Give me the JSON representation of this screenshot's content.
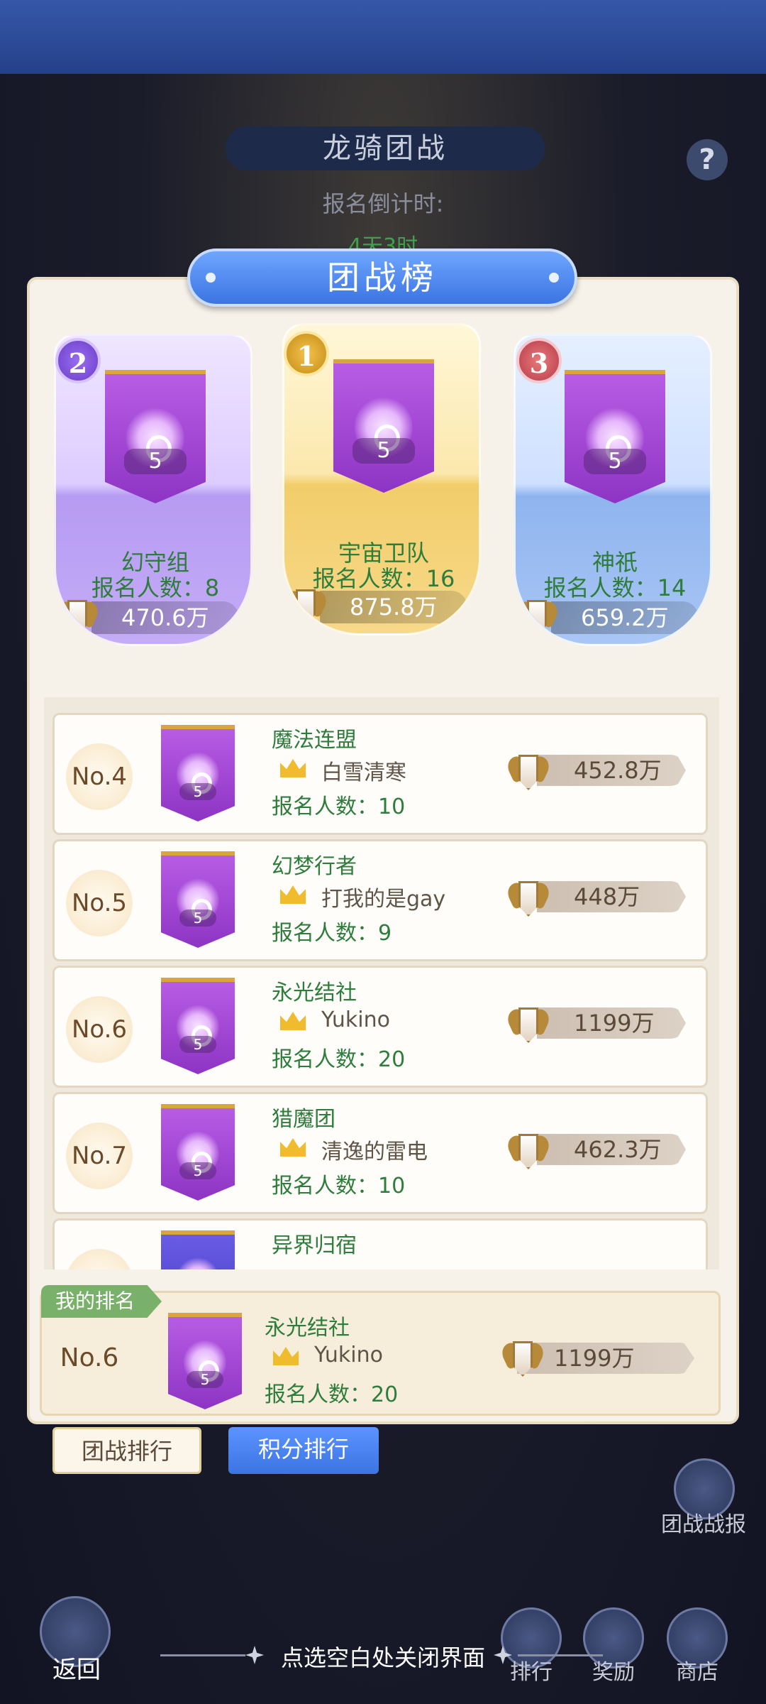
{
  "background": {
    "title": "龙骑团战",
    "countdown_label": "报名倒计时:",
    "countdown_value": "4天3时"
  },
  "panel": {
    "title": "团战榜"
  },
  "podium": [
    {
      "rank": "2",
      "name": "幻守组",
      "count_label": "报名人数：8",
      "score": "470.6万",
      "level": "5"
    },
    {
      "rank": "1",
      "name": "宇宙卫队",
      "count_label": "报名人数：16",
      "score": "875.8万",
      "level": "5"
    },
    {
      "rank": "3",
      "name": "神祇",
      "count_label": "报名人数：14",
      "score": "659.2万",
      "level": "5"
    }
  ],
  "list": [
    {
      "rank": "No.4",
      "name": "魔法连盟",
      "leader": "白雪清寒",
      "count_label": "报名人数：10",
      "score": "452.8万",
      "level": "5"
    },
    {
      "rank": "No.5",
      "name": "幻梦行者",
      "leader": "打我的是gay",
      "count_label": "报名人数：9",
      "score": "448万",
      "level": "5"
    },
    {
      "rank": "No.6",
      "name": "永光结社",
      "leader": "Yukino",
      "count_label": "报名人数：20",
      "score": "1199万",
      "level": "5"
    },
    {
      "rank": "No.7",
      "name": "猎魔团",
      "leader": "清逸的雷电",
      "count_label": "报名人数：10",
      "score": "462.3万",
      "level": "5"
    },
    {
      "rank": "",
      "name": "异界归宿",
      "leader": "",
      "count_label": "",
      "score": "",
      "level": ""
    }
  ],
  "my_rank": {
    "label": "我的排名",
    "rank": "No.6",
    "name": "永光结社",
    "leader": "Yukino",
    "count_label": "报名人数：20",
    "score": "1199万",
    "level": "5"
  },
  "tabs": {
    "team_rank": "团战排行",
    "score_rank": "积分排行"
  },
  "side": {
    "battle_report": "团战战报"
  },
  "bottom": {
    "back": "返回",
    "rank": "排行",
    "reward": "奖励",
    "shop": "商店",
    "hint": "点选空白处关闭界面"
  },
  "colors": {
    "accent_blue": "#3c74e2",
    "team_name_green": "#2f7d3c",
    "panel_bg": "#f6f2ea"
  }
}
